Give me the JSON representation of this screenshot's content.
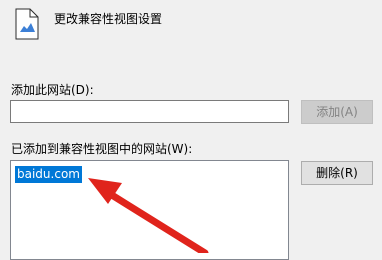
{
  "title": "更改兼容性视图设置",
  "add_site": {
    "label": "添加此网站(D):",
    "input_value": "",
    "add_button": "添加(A)"
  },
  "site_list": {
    "label": "已添加到兼容性视图中的网站(W):",
    "items": [
      "baidu.com"
    ],
    "remove_button": "删除(R)"
  },
  "colors": {
    "selection": "#0078d7",
    "annotation_arrow": "#e0241c"
  },
  "icons": {
    "title_icon": "document-settings-icon",
    "annotation": "red-arrow-icon"
  }
}
